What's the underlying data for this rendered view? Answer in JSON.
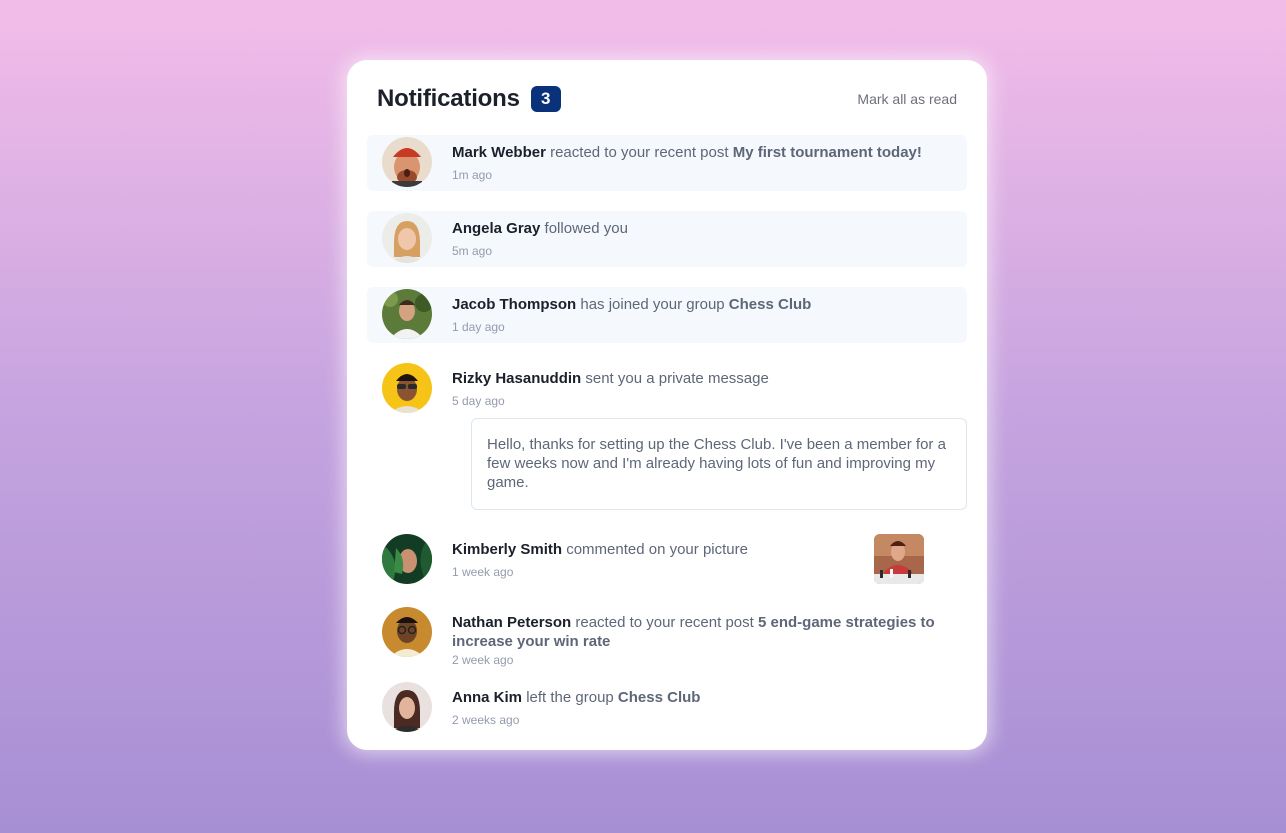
{
  "header": {
    "title": "Notifications",
    "unread_count": "3",
    "mark_all_label": "Mark all as read"
  },
  "colors": {
    "badge": "#0a327b",
    "unread_bg": "#f5f8fc",
    "text_dark": "#1c202b",
    "text_muted": "#5e6778"
  },
  "notifications": [
    {
      "actor": "Mark Webber",
      "action": "reacted to your recent post",
      "target": "My first tournament today!",
      "time": "1m ago",
      "unread": true
    },
    {
      "actor": "Angela Gray",
      "action": "followed you",
      "target": "",
      "time": "5m ago",
      "unread": true
    },
    {
      "actor": "Jacob Thompson",
      "action": "has joined your group",
      "target": "Chess Club",
      "time": "1 day ago",
      "unread": true
    },
    {
      "actor": "Rizky Hasanuddin",
      "action": "sent you a private message",
      "target": "",
      "time": "5 day ago",
      "unread": false,
      "message": "Hello, thanks for setting up the Chess Club. I've been a member for a few weeks now and I'm already having lots of fun and improving my game."
    },
    {
      "actor": "Kimberly Smith",
      "action": "commented on your picture",
      "target": "",
      "time": "1 week ago",
      "unread": false
    },
    {
      "actor": "Nathan Peterson",
      "action": "reacted to your recent post",
      "target": "5 end-game strategies to increase your win rate",
      "time": "2 week ago",
      "unread": false
    },
    {
      "actor": "Anna Kim",
      "action": "left the group",
      "target": "Chess Club",
      "time": "2 weeks ago",
      "unread": false
    }
  ]
}
